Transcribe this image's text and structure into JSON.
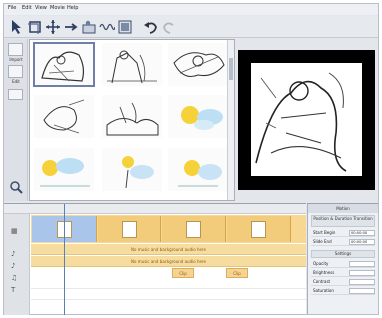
{
  "menubar": {
    "items": [
      "File",
      "Edit",
      "View",
      "Movie",
      "Help"
    ]
  },
  "toolbar": {
    "buttons": [
      "pointer-icon",
      "crop-icon",
      "pan-icon",
      "arrow-icon",
      "slide-icon",
      "audio-icon",
      "export-icon",
      "undo-icon",
      "redo-icon"
    ]
  },
  "sidebar": {
    "buttons": [
      "Import",
      "Edit"
    ]
  },
  "timeline": {
    "audio_rows": [
      "No music and background audio here",
      "No music and background audio here"
    ],
    "audio_clips": [
      "Clip",
      "Clip"
    ]
  },
  "properties": {
    "header": "Motion",
    "section1": "Position & Duration Transition",
    "rows1": [
      {
        "label": "Start Begin",
        "value": "00:00:00"
      },
      {
        "label": "Slide End",
        "value": "00:00:00"
      }
    ],
    "section2": "Settings",
    "rows2": [
      {
        "label": "Opacity",
        "value": ""
      },
      {
        "label": "Brightness",
        "value": ""
      },
      {
        "label": "Contrast",
        "value": ""
      },
      {
        "label": "Saturation",
        "value": ""
      }
    ]
  },
  "colors": {
    "accent": "#6f7fa8",
    "track": "#f7d792",
    "selected_clip": "#a9c5ea",
    "preview_bg": "#000000"
  }
}
